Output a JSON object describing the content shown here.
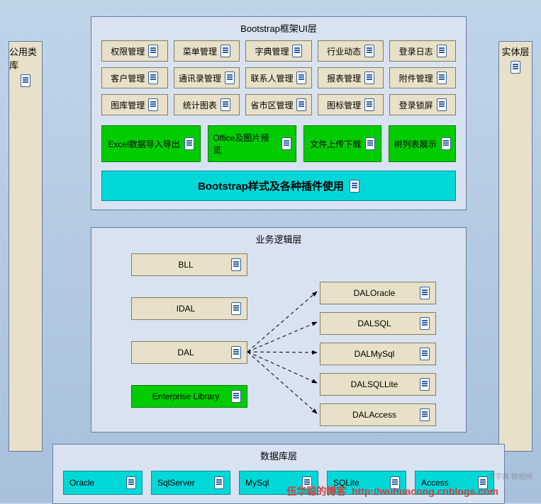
{
  "left_panel": {
    "label": "公用类库"
  },
  "right_panel": {
    "label": "实体层"
  },
  "ui_layer": {
    "title": "Bootstrap框架UI层",
    "row1": [
      "权限管理",
      "菜单管理",
      "字典管理",
      "行业动态",
      "登录日志"
    ],
    "row2": [
      "客户管理",
      "通讯录管理",
      "联系人管理",
      "报表管理",
      "附件管理"
    ],
    "row3": [
      "图库管理",
      "统计图表",
      "省市区管理",
      "图标管理",
      "登录锁屏"
    ],
    "green": [
      "Excel数据导入导出",
      "Office及图片预览",
      "文件上传下载",
      "树列表展示"
    ],
    "wide": "Bootstrap样式及各种插件使用"
  },
  "logic_layer": {
    "title": "业务逻辑层",
    "left": [
      "BLL",
      "IDAL",
      "DAL"
    ],
    "left_green": "Enterprise Library",
    "right": [
      "DALOracle",
      "DALSQL",
      "DALMySql",
      "DALSQLLite",
      "DALAccess"
    ]
  },
  "db_layer": {
    "title": "数据库层",
    "items": [
      "Oracle",
      "SqlServer",
      "MySql",
      "SQLite",
      "Access"
    ]
  },
  "watermark_left": "伍华聪的博客",
  "watermark_right": "http://wuhuacong.cnblogs.com",
  "watermark_small": "李宇典 教程网"
}
